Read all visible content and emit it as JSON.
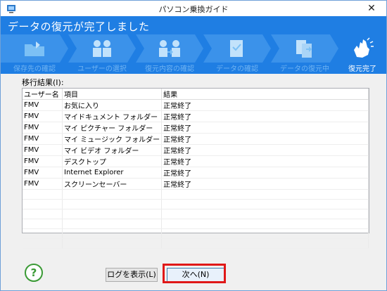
{
  "window": {
    "title": "パソコン乗換ガイド",
    "close_glyph": "✕"
  },
  "header": {
    "title": "データの復元が完了しました"
  },
  "steps": [
    {
      "label": "保存先の確認",
      "icon": "folder-icon"
    },
    {
      "label": "ユーザーの選択",
      "icon": "users-icon"
    },
    {
      "label": "復元内容の確認",
      "icon": "users-transfer-icon"
    },
    {
      "label": "データの確認",
      "icon": "document-check-icon"
    },
    {
      "label": "データの復元中",
      "icon": "copy-icon"
    },
    {
      "label": "復元完了",
      "icon": "clap-icon"
    }
  ],
  "colors": {
    "accent": "#1f7ee3",
    "highlight": "#e01818",
    "help": "#3a9a35"
  },
  "results": {
    "label": "移行結果(I):",
    "columns": [
      "ユーザー名",
      "項目",
      "結果"
    ],
    "rows": [
      [
        "FMV",
        "お気に入り",
        "正常終了"
      ],
      [
        "FMV",
        "マイドキュメント フォルダー",
        "正常終了"
      ],
      [
        "FMV",
        "マイ ピクチャー フォルダー",
        "正常終了"
      ],
      [
        "FMV",
        "マイ ミュージック フォルダー",
        "正常終了"
      ],
      [
        "FMV",
        "マイ ビデオ フォルダー",
        "正常終了"
      ],
      [
        "FMV",
        "デスクトップ",
        "正常終了"
      ],
      [
        "FMV",
        "Internet Explorer",
        "正常終了"
      ],
      [
        "FMV",
        "スクリーンセーバー",
        "正常終了"
      ]
    ]
  },
  "footer": {
    "help_glyph": "?",
    "log_button": "ログを表示(L)",
    "next_button": "次へ(N)"
  }
}
